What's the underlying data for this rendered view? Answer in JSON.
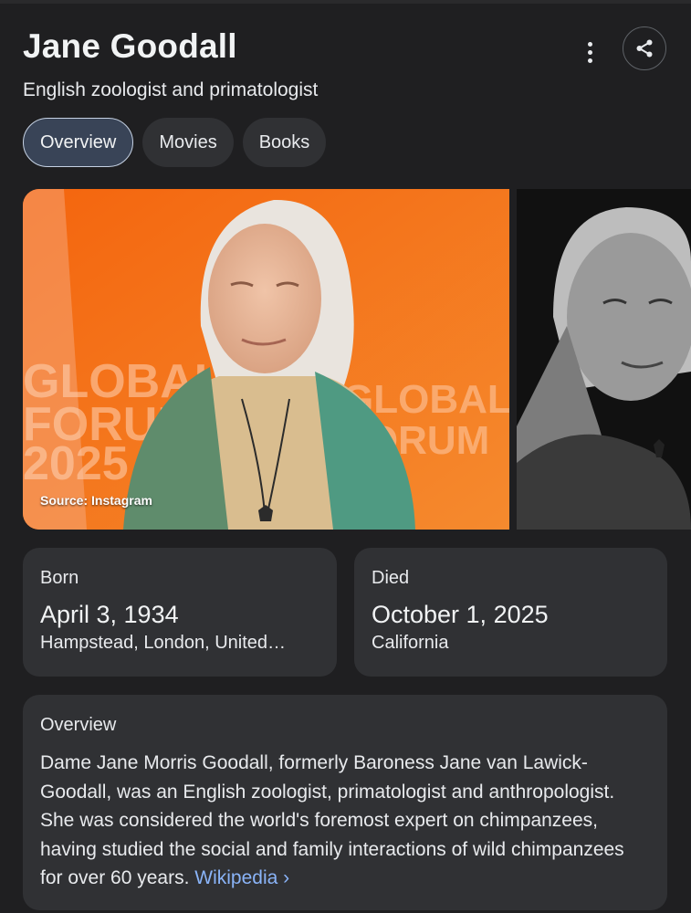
{
  "header": {
    "title": "Jane Goodall",
    "subtitle": "English zoologist and primatologist"
  },
  "tabs": [
    {
      "label": "Overview",
      "active": true
    },
    {
      "label": "Movies",
      "active": false
    },
    {
      "label": "Books",
      "active": false
    }
  ],
  "images": {
    "source_label": "Source: Instagram",
    "background_text": [
      "GLOBAL",
      "FORUM",
      "2025"
    ]
  },
  "facts": {
    "born": {
      "label": "Born",
      "value": "April 3, 1934",
      "place": "Hampstead, London, United…"
    },
    "died": {
      "label": "Died",
      "value": "October 1, 2025",
      "place": "California"
    }
  },
  "overview": {
    "heading": "Overview",
    "text": "Dame Jane Morris Goodall, formerly Baroness Jane van Lawick-Goodall, was an English zoologist, primatologist and anthropologist. She was considered the world's foremost expert on chimpanzees, having studied the social and family interactions of wild chimpanzees for over 60 years.",
    "link_label": "Wikipedia",
    "link_chevron": "›"
  },
  "colors": {
    "background": "#1f1f21",
    "card": "#303134",
    "link": "#8ab4f8",
    "active_tab": "#394457"
  },
  "icons": [
    "more-vert-icon",
    "share-icon",
    "chevron-right-icon"
  ]
}
